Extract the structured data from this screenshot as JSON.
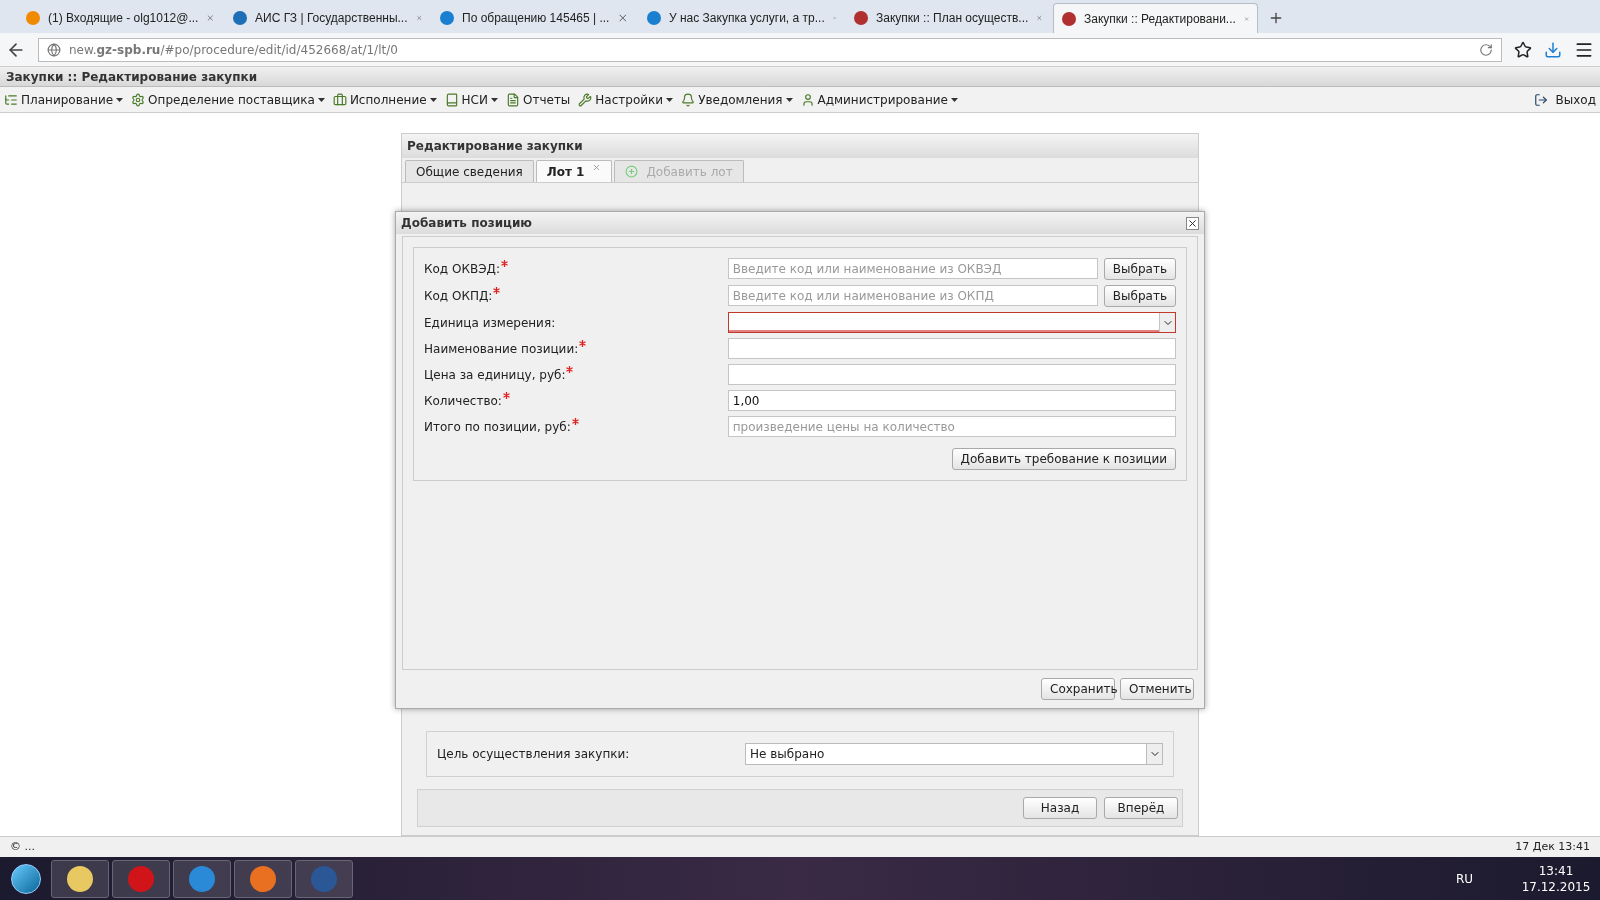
{
  "browser": {
    "tabs": [
      {
        "title": "(1) Входящие - olg1012@...",
        "selected": false
      },
      {
        "title": "АИС ГЗ | Государственны...",
        "selected": false
      },
      {
        "title": "По обращению 145465 | ...",
        "selected": false
      },
      {
        "title": "У нас Закупка услуги, а тр...",
        "selected": false
      },
      {
        "title": "Закупки :: План осуществ...",
        "selected": false
      },
      {
        "title": "Закупки :: Редактировани...",
        "selected": true
      }
    ],
    "address": "new.**gz-spb.ru**/#po/procedure/edit/id/452668/at/1/lt/0"
  },
  "app": {
    "title": "Закупки :: Редактирование закупки",
    "menu": [
      {
        "label": "Планирование",
        "has_dropdown": true
      },
      {
        "label": "Определение поставщика",
        "has_dropdown": true
      },
      {
        "label": "Исполнение",
        "has_dropdown": true
      },
      {
        "label": "НСИ",
        "has_dropdown": true
      },
      {
        "label": "Отчеты",
        "has_dropdown": false
      },
      {
        "label": "Настройки",
        "has_dropdown": true
      },
      {
        "label": "Уведомления",
        "has_dropdown": true
      },
      {
        "label": "Администрирование",
        "has_dropdown": true
      }
    ],
    "logout": "Выход"
  },
  "panel": {
    "title": "Редактирование закупки",
    "tabs": [
      {
        "label": "Общие сведения",
        "selected": false,
        "closable": false,
        "disabled": false
      },
      {
        "label": "Лот 1",
        "selected": true,
        "closable": true,
        "disabled": false
      },
      {
        "label": "Добавить лот",
        "selected": false,
        "closable": false,
        "disabled": true
      }
    ],
    "purpose_label": "Цель осуществления закупки:",
    "purpose_value": "Не выбрано",
    "buttons": [
      "Назад",
      "Вперёд"
    ]
  },
  "dialog": {
    "title": "Добавить позицию",
    "fields": [
      {
        "label": "Код ОКВЭД:",
        "required": true,
        "kind": "lookup",
        "placeholder": "Введите код или наименование из ОКВЭД",
        "button": "Выбрать"
      },
      {
        "label": "Код ОКПД:",
        "required": true,
        "kind": "lookup",
        "placeholder": "Введите код или наименование из ОКПД",
        "button": "Выбрать"
      },
      {
        "label": "Единица измерения:",
        "required": false,
        "kind": "select",
        "invalid": true
      },
      {
        "label": "Наименование позиции:",
        "required": true,
        "kind": "text"
      },
      {
        "label": "Цена за единицу, руб:",
        "required": true,
        "kind": "text"
      },
      {
        "label": "Количество:",
        "required": true,
        "kind": "text",
        "value": "1,00"
      },
      {
        "label": "Итого по позиции, руб:",
        "required": true,
        "kind": "text",
        "placeholder": "произведение цены на количество"
      }
    ],
    "add_requirement": "Добавить требование к позиции",
    "buttons": [
      "Сохранить",
      "Отменить"
    ]
  },
  "status_bar": {
    "left": "© ...",
    "right": "17 Дек 13:41"
  },
  "taskbar": {
    "language": "RU",
    "time": "13:41",
    "date": "17.12.2015"
  }
}
